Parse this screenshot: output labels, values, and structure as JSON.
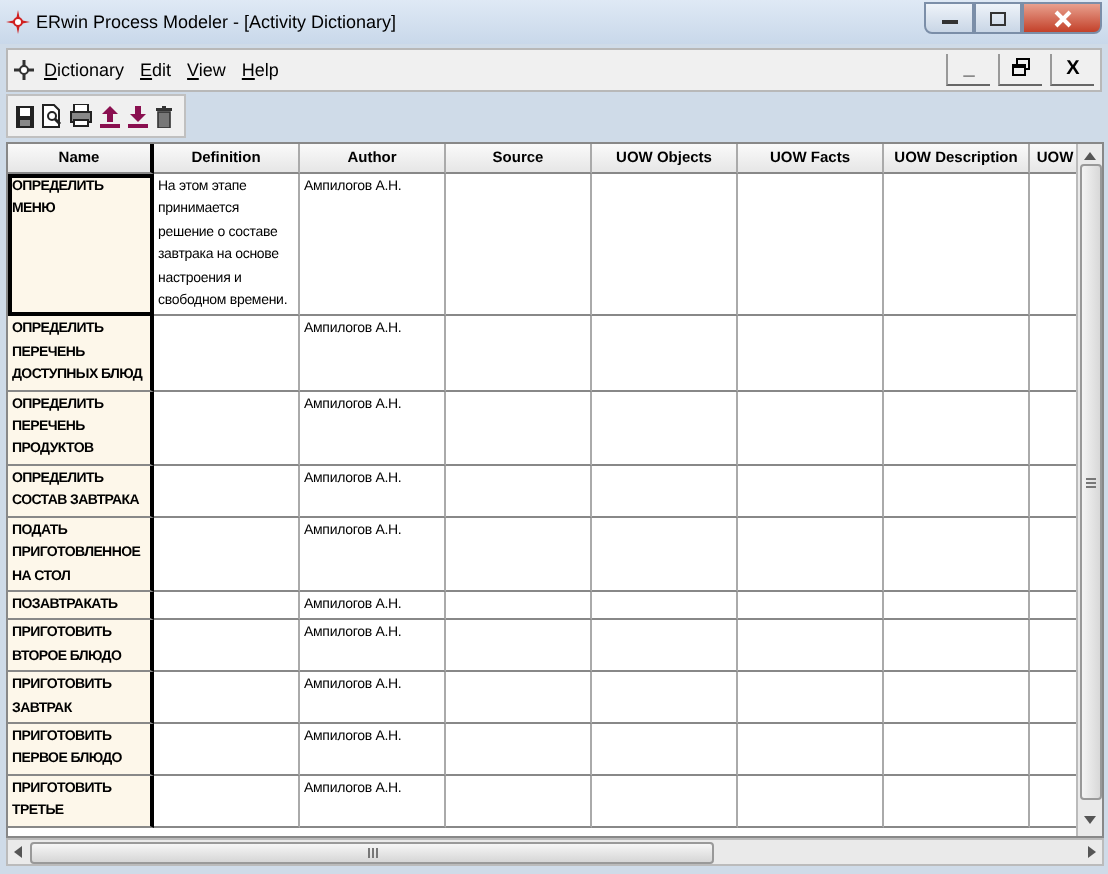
{
  "window": {
    "title": "ERwin Process Modeler - [Activity Dictionary]"
  },
  "menu": [
    "Dictionary",
    "Edit",
    "View",
    "Help"
  ],
  "mdi_buttons": [
    "_",
    "X"
  ],
  "table": {
    "columns": [
      "Name",
      "Definition",
      "Author",
      "Source",
      "UOW Objects",
      "UOW Facts",
      "UOW Description",
      "UOW"
    ],
    "rows": [
      {
        "name": "ОПРЕДЕЛИТЬ МЕНЮ",
        "definition": "На этом этапе принимается решение о составе завтрака на основе настроения и свободном времени.",
        "author": "Ампилогов А.Н.",
        "selected": true
      },
      {
        "name": "ОПРЕДЕЛИТЬ ПЕРЕЧЕНЬ ДОСТУПНЫХ БЛЮД",
        "author": "Ампилогов А.Н.",
        "selected": false
      },
      {
        "name": "ОПРЕДЕЛИТЬ ПЕРЕЧЕНЬ ПРОДУКТОВ",
        "author": "Ампилогов А.Н.",
        "selected": false
      },
      {
        "name": "ОПРЕДЕЛИТЬ СОСТАВ ЗАВТРАКА",
        "author": "Ампилогов А.Н.",
        "selected": false
      },
      {
        "name": "ПОДАТЬ ПРИГОТОВЛЕННОЕ НА СТОЛ",
        "author": "Ампилогов А.Н.",
        "selected": false
      },
      {
        "name": "ПОЗАВТРАКАТЬ",
        "author": "Ампилогов А.Н.",
        "selected": false
      },
      {
        "name": "ПРИГОТОВИТЬ ВТОРОЕ БЛЮДО",
        "author": "Ампилогов А.Н.",
        "selected": false
      },
      {
        "name": "ПРИГОТОВИТЬ ЗАВТРАК",
        "author": "Ампилогов А.Н.",
        "selected": false
      },
      {
        "name": "ПРИГОТОВИТЬ ПЕРВОЕ БЛЮДО",
        "author": "Ампилогов А.Н.",
        "selected": false
      },
      {
        "name": "ПРИГОТОВИТЬ ТРЕТЬЕ",
        "author": "Ампилогов А.Н.",
        "selected": false
      }
    ]
  }
}
